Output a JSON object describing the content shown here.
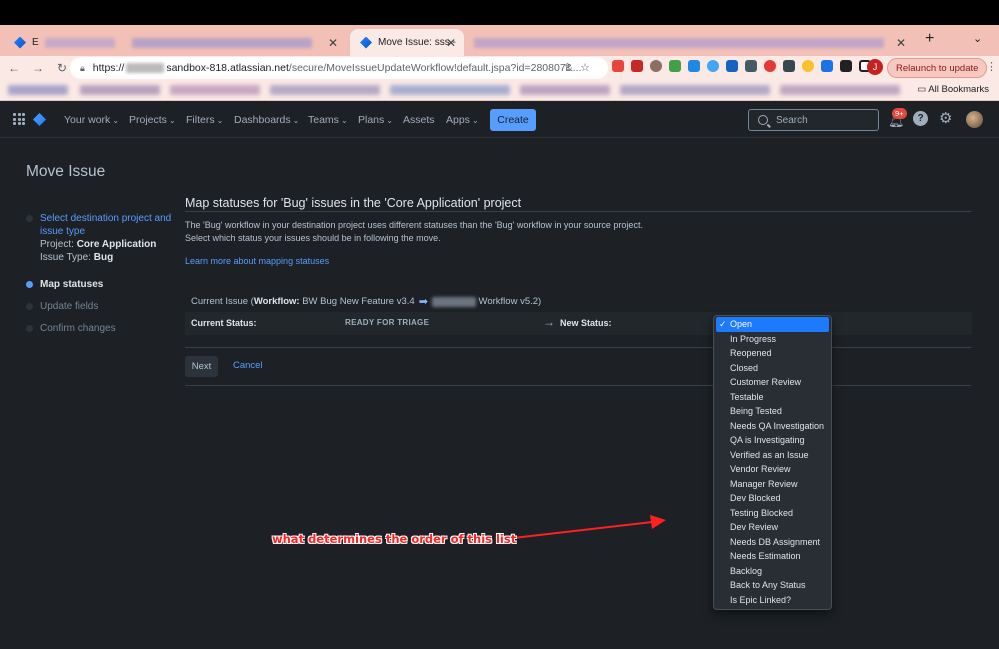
{
  "browser": {
    "tabs": [
      {
        "label": "E",
        "active": false
      },
      {
        "label": "",
        "active": false
      },
      {
        "label": "Move Issue: sss -",
        "active": true
      },
      {
        "label": "",
        "active": false
      }
    ],
    "new_tab_symbol": "+",
    "url_prefix": "https://",
    "url_host": "sandbox-818.atlassian.net",
    "url_path": "/secure/MoveIssueUpdateWorkflow!default.jspa?id=280807&...",
    "profile_initial": "J",
    "relaunch_label": "Relaunch to update",
    "all_bookmarks_label": "All Bookmarks"
  },
  "jira_nav": {
    "items": [
      "Your work",
      "Projects",
      "Filters",
      "Dashboards",
      "Teams",
      "Plans",
      "Assets",
      "Apps"
    ],
    "create_label": "Create",
    "search_placeholder": "Search",
    "notification_count": "9+",
    "help_symbol": "?"
  },
  "page": {
    "title": "Move Issue",
    "steps": {
      "step1_link": "Select destination project and issue type",
      "project_label": "Project:",
      "project_value": "Core Application",
      "issue_type_label": "Issue Type:",
      "issue_type_value": "Bug",
      "step2": "Map statuses",
      "step3": "Update fields",
      "step4": "Confirm changes"
    },
    "section_title": "Map statuses for 'Bug' issues in the 'Core Application' project",
    "description_line1": "The 'Bug' workflow in your destination project uses different statuses than the 'Bug' workflow in your source project.",
    "description_line2": "Select which status your issues should be in following the move.",
    "learn_more": "Learn more about mapping statuses",
    "workflow": {
      "prefix": "Current Issue (",
      "label": "Workflow:",
      "from": "BW Bug New Feature v3.4",
      "to_suffix": "Workflow v5.2)"
    },
    "status_row": {
      "current_label": "Current Status:",
      "current_value": "READY FOR TRIAGE",
      "new_label": "New Status:"
    },
    "next_label": "Next",
    "cancel_label": "Cancel"
  },
  "dropdown": {
    "selected": "Open",
    "check_symbol": "✓",
    "options": [
      "Open",
      "In Progress",
      "Reopened",
      "Closed",
      "Customer Review",
      "Testable",
      "Being Tested",
      "Needs QA Investigation",
      "QA is Investigating",
      "Verified as an Issue",
      "Vendor Review",
      "Manager Review",
      "Dev Blocked",
      "Testing Blocked",
      "Dev Review",
      "Needs DB Assignment",
      "Needs Estimation",
      "Backlog",
      "Back to Any Status",
      "Is Epic Linked?"
    ]
  },
  "annotation": {
    "text": "what determines the order of this list",
    "color": "#ff2020"
  }
}
